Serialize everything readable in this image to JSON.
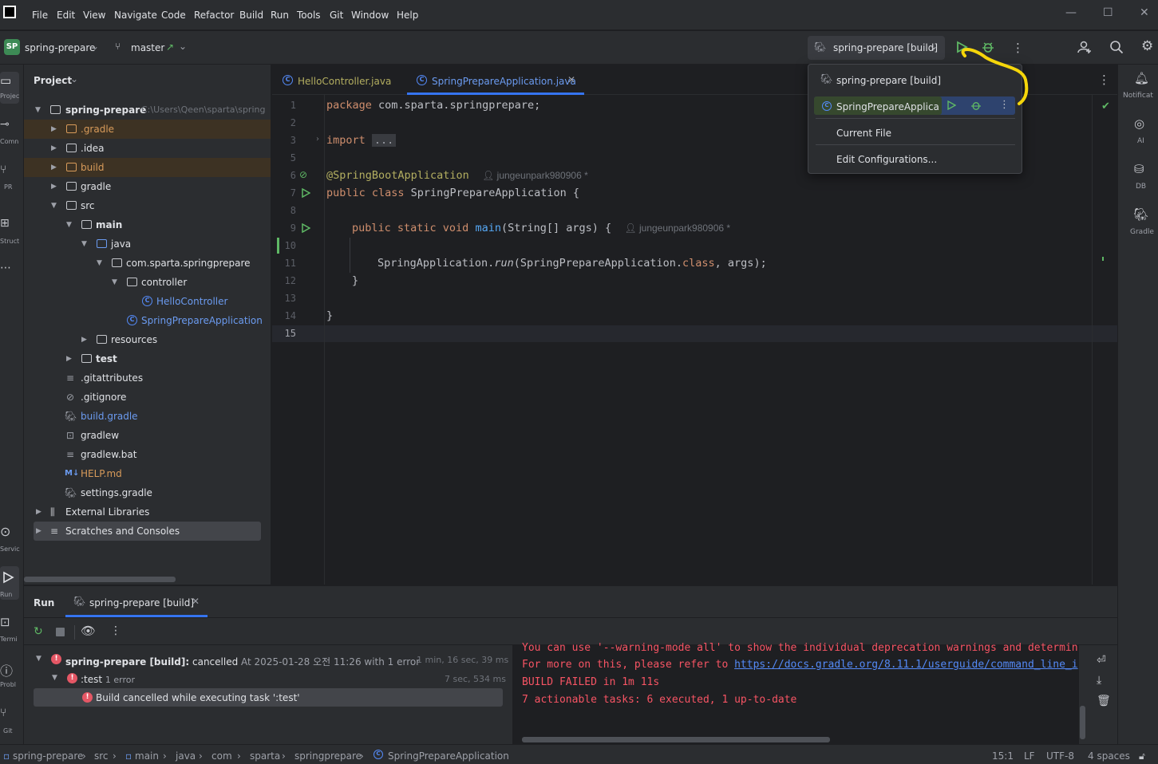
{
  "menu": [
    "File",
    "Edit",
    "View",
    "Navigate",
    "Code",
    "Refactor",
    "Build",
    "Run",
    "Tools",
    "Git",
    "Window",
    "Help"
  ],
  "toolbar": {
    "project_badge": "SP",
    "project": "spring-prepare",
    "branch": "master",
    "run_config": "spring-prepare [build]"
  },
  "stripe_left": [
    "Projec",
    "Comn",
    "PR",
    "Struct",
    "Servic",
    "Run",
    "Termi",
    "Probl",
    "Git"
  ],
  "stripe_right": [
    "Notificat",
    "AI",
    "DB",
    "Gradle"
  ],
  "project_panel": {
    "title": "Project",
    "root": "spring-prepare",
    "root_path": "C:\\Users\\Qeen\\sparta\\spring",
    "items": [
      ".gradle",
      ".idea",
      "build",
      "gradle",
      "src",
      "main",
      "java",
      "com.sparta.springprepare",
      "controller",
      "HelloController",
      "SpringPrepareApplication",
      "resources",
      "test",
      ".gitattributes",
      ".gitignore",
      "build.gradle",
      "gradlew",
      "gradlew.bat",
      "HELP.md",
      "settings.gradle",
      "External Libraries",
      "Scratches and Consoles"
    ]
  },
  "editor": {
    "tabs": [
      "HelloController.java",
      "SpringPrepareApplication.java"
    ],
    "lines": [
      "1",
      "2",
      "3",
      "5",
      "6",
      "7",
      "8",
      "9",
      "10",
      "11",
      "12",
      "13",
      "14",
      "15"
    ],
    "code": {
      "l1_kw": "package",
      "l1_rest": " com.sparta.springprepare;",
      "l3_kw": "import",
      "l3_fold": "...",
      "l6_ann": "@SpringBootApplication",
      "author": "jungeunpark980906 *",
      "l7_kw": "public class",
      "l7_rest": " SpringPrepareApplication {",
      "l9_kw": "public static void",
      "l9_fn": "main",
      "l9_rest": "(String[] args) {",
      "l11_a": "SpringApplication.",
      "l11_it": "run",
      "l11_b": "(SpringPrepareApplication.",
      "l11_kw": "class",
      "l11_c": ", args);",
      "l12": "}",
      "l14": "}"
    }
  },
  "popup": {
    "items": [
      "spring-prepare [build]",
      "SpringPrepareApplicati",
      "Current File",
      "Edit Configurations..."
    ]
  },
  "run_panel": {
    "title": "Run",
    "tab": "spring-prepare [build]",
    "tree": [
      {
        "bold": "spring-prepare [build]:",
        "label": " cancelled",
        "meta": "At 2025-01-28 오전 11:26 with 1 error",
        "time": "1 min, 16 sec, 39 ms"
      },
      {
        "label": ":test",
        "meta": "1 error",
        "time": "7 sec, 534 ms"
      },
      {
        "label": "Build cancelled while executing task ':test'"
      }
    ],
    "console": {
      "l0": "You can use '--warning-mode all' to show the individual deprecation warnings and determin",
      "l1_pre": "For more on this, please refer to ",
      "l1_link": "https://docs.gradle.org/8.11.1/userguide/command_line_i",
      "l2": "BUILD FAILED in 1m 11s",
      "l3": "7 actionable tasks: 6 executed, 1 up-to-date"
    }
  },
  "statusbar": {
    "crumbs": [
      "spring-prepare",
      "src",
      "main",
      "java",
      "com",
      "sparta",
      "springprepare",
      "SpringPrepareApplication"
    ],
    "pos": "15:1",
    "eol": "LF",
    "enc": "UTF-8",
    "indent": "4 spaces"
  }
}
